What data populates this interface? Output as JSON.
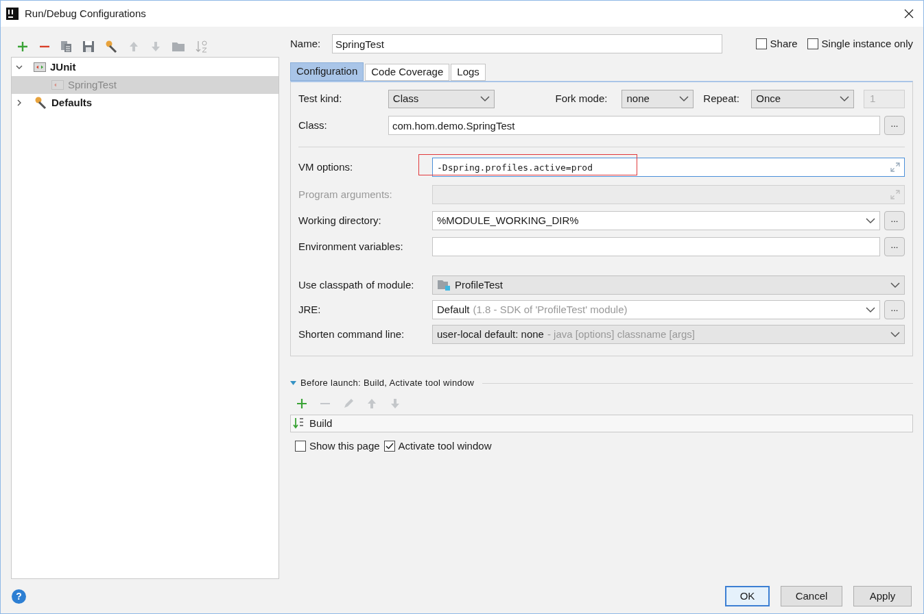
{
  "window": {
    "title": "Run/Debug Configurations"
  },
  "tree": [
    {
      "kind": "junit",
      "label": "JUnit",
      "expanded": true,
      "selected": false,
      "children": [
        {
          "kind": "test",
          "label": "SpringTest",
          "selected": true
        }
      ]
    },
    {
      "kind": "defaults",
      "label": "Defaults",
      "expanded": false,
      "selected": false
    }
  ],
  "name": {
    "label": "Name:",
    "value": "SpringTest"
  },
  "options": [
    {
      "label": "Share",
      "checked": false
    },
    {
      "label": "Single instance only",
      "checked": false
    }
  ],
  "tabs": [
    {
      "label": "Configuration",
      "selected": true
    },
    {
      "label": "Code Coverage",
      "selected": false
    },
    {
      "label": "Logs",
      "selected": false
    }
  ],
  "test_kind": {
    "label": "Test kind:",
    "value": "Class",
    "fork_label": "Fork mode:",
    "fork_value": "none",
    "repeat_label": "Repeat:",
    "repeat_value": "Once",
    "count": "1"
  },
  "class_field": {
    "label": "Class:",
    "value": "com.hom.demo.SpringTest",
    "browse_label": "..."
  },
  "fields": [
    {
      "kind": "text",
      "label": "VM options:",
      "value": "-Dspring.profiles.active=prod",
      "disabled": false,
      "focused": true,
      "highlighted": true,
      "expand": true
    },
    {
      "kind": "text",
      "label": "Program arguments:",
      "disabled": true,
      "focused": false,
      "highlighted": false,
      "expand": true
    },
    {
      "kind": "editable_combo",
      "label": "Working directory:",
      "value": "%MODULE_WORKING_DIR%",
      "disabled": false,
      "focused": false,
      "highlighted": false,
      "expand": false,
      "browse_label": "..."
    },
    {
      "kind": "text",
      "label": "Environment variables:",
      "disabled": false,
      "focused": false,
      "highlighted": false,
      "expand": false,
      "browse_label": "..."
    }
  ],
  "module_fields": [
    {
      "kind": "module_combo",
      "label": "Use classpath of module:",
      "value": "ProfileTest"
    },
    {
      "kind": "editable_combo",
      "label": "JRE:",
      "value": "Default",
      "hint": "(1.8 - SDK of 'ProfileTest' module)",
      "browse_label": "..."
    },
    {
      "kind": "combo",
      "label": "Shorten command line:",
      "value": "user-local default: none",
      "hint": "- java [options] classname [args]"
    }
  ],
  "help": "?",
  "before_launch": {
    "title": "Before launch: Build, Activate tool window",
    "expanded": true,
    "tasks": [
      "Build"
    ]
  },
  "launch_options": [
    {
      "label": "Show this page",
      "checked": false
    },
    {
      "label": "Activate tool window",
      "checked": true
    }
  ],
  "buttons": [
    {
      "label": "OK",
      "default": true
    },
    {
      "label": "Cancel",
      "default": false
    },
    {
      "label": "Apply",
      "default": false
    }
  ]
}
